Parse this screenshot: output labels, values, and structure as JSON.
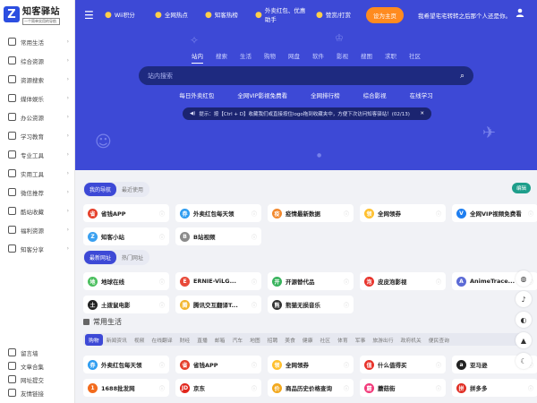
{
  "logo": {
    "mark": "Z",
    "title": "知客驿站",
    "sub": "一个简单实用的导航"
  },
  "sidebar": {
    "items": [
      {
        "label": "常用生活",
        "icon": "bookmark-icon"
      },
      {
        "label": "综合资源",
        "icon": "grid-icon"
      },
      {
        "label": "资源搜索",
        "icon": "search-icon"
      },
      {
        "label": "媒体娱乐",
        "icon": "media-icon"
      },
      {
        "label": "办公资源",
        "icon": "monitor-icon"
      },
      {
        "label": "学习教育",
        "icon": "book-icon"
      },
      {
        "label": "专业工具",
        "icon": "gear-icon"
      },
      {
        "label": "实用工具",
        "icon": "wrench-icon"
      },
      {
        "label": "微信推荐",
        "icon": "wechat-icon"
      },
      {
        "label": "酷站收藏",
        "icon": "star-icon"
      },
      {
        "label": "福利资源",
        "icon": "gift-icon"
      },
      {
        "label": "知客分享",
        "icon": "share-icon"
      }
    ],
    "bottom": [
      {
        "label": "留言墙",
        "icon": "message-icon"
      },
      {
        "label": "文章合集",
        "icon": "article-icon"
      },
      {
        "label": "网址提交",
        "icon": "send-icon"
      },
      {
        "label": "友情链接",
        "icon": "link-icon"
      }
    ]
  },
  "topbar": {
    "links": [
      "Wii积分",
      "全网热点",
      "知客热榜",
      "外卖红包、优惠助手",
      "赞赏/打赏"
    ],
    "set_home": "设为主页",
    "marquee": "我希望宅宅转转之后那个人还是你。"
  },
  "search": {
    "tabs": [
      "站内",
      "搜索",
      "生活",
      "购物",
      "网盘",
      "软件",
      "影视",
      "搜图",
      "求职",
      "社区"
    ],
    "active_tab": "站内",
    "placeholder": "站内搜索"
  },
  "hot_links": [
    "每日外卖红包",
    "全网VIP影视免费看",
    "全网排行榜",
    "综合影视",
    "在线学习"
  ],
  "notice": "提示：按【Ctrl + D】收藏我们或直接按住logo拖到收藏夹中，方便下次访问知客驿站！(02/13)",
  "my_nav": {
    "tabs": [
      "我的导航",
      "最近使用"
    ],
    "edit": "编辑",
    "sites": [
      {
        "name": "省钱APP",
        "color": "#e5402b",
        "glyph": "省"
      },
      {
        "name": "外卖红包每天领",
        "color": "#2e9cf0",
        "glyph": "券"
      },
      {
        "name": "疫情最新数据",
        "color": "#f2892e",
        "glyph": "疫"
      },
      {
        "name": "全网领券",
        "color": "#ffc02e",
        "glyph": "领"
      },
      {
        "name": "全网VIP视频免费看",
        "color": "#1e7ef0",
        "glyph": "V"
      },
      {
        "name": "知客小站",
        "color": "#3aa0f0",
        "glyph": "Z"
      },
      {
        "name": "B站视频",
        "color": "#8a8a8a",
        "glyph": "B"
      }
    ]
  },
  "latest": {
    "tabs": [
      "最新网址",
      "热门网址"
    ],
    "sites": [
      {
        "name": "地球在线",
        "color": "#4bbf5e",
        "glyph": "地"
      },
      {
        "name": "ERNIE-ViLG...",
        "color": "#e84a3a",
        "glyph": "E"
      },
      {
        "name": "开源替代品",
        "color": "#38b35c",
        "glyph": "开"
      },
      {
        "name": "皮皮泡影视",
        "color": "#e8332b",
        "glyph": "泡"
      },
      {
        "name": "AnimeTrace...",
        "color": "#5c6bd6",
        "glyph": "A"
      },
      {
        "name": "土拨鼠电影",
        "color": "#222222",
        "glyph": "土"
      },
      {
        "name": "腾讯交互翻译T...",
        "color": "#f2b52e",
        "glyph": "腾"
      },
      {
        "name": "熊猫无损音乐",
        "color": "#333333",
        "glyph": "熊"
      }
    ]
  },
  "life": {
    "title": "常用生活",
    "categories": [
      "购物",
      "新闻资讯",
      "视频",
      "在线翻译",
      "财经",
      "直播",
      "邮箱",
      "汽车",
      "地图",
      "招聘",
      "美食",
      "健康",
      "社区",
      "体育",
      "军事",
      "旅游出行",
      "政府机关",
      "便民查询"
    ],
    "active": "购物",
    "sites": [
      {
        "name": "外卖红包每天领",
        "color": "#2e9cf0",
        "glyph": "券"
      },
      {
        "name": "省钱APP",
        "color": "#e5402b",
        "glyph": "省"
      },
      {
        "name": "全网领券",
        "color": "#ffc02e",
        "glyph": "领"
      },
      {
        "name": "什么值得买",
        "color": "#e8332b",
        "glyph": "值"
      },
      {
        "name": "亚马逊",
        "color": "#222222",
        "glyph": "a"
      },
      {
        "name": "1688批发网",
        "color": "#f26b1d",
        "glyph": "1"
      },
      {
        "name": "京东",
        "color": "#e1251b",
        "glyph": "JD"
      },
      {
        "name": "商品历史价格查询",
        "color": "#f2a81d",
        "glyph": "价"
      },
      {
        "name": "蘑菇街",
        "color": "#f23a7a",
        "glyph": "蘑"
      },
      {
        "name": "拼多多",
        "color": "#e02e24",
        "glyph": "拼"
      }
    ]
  }
}
